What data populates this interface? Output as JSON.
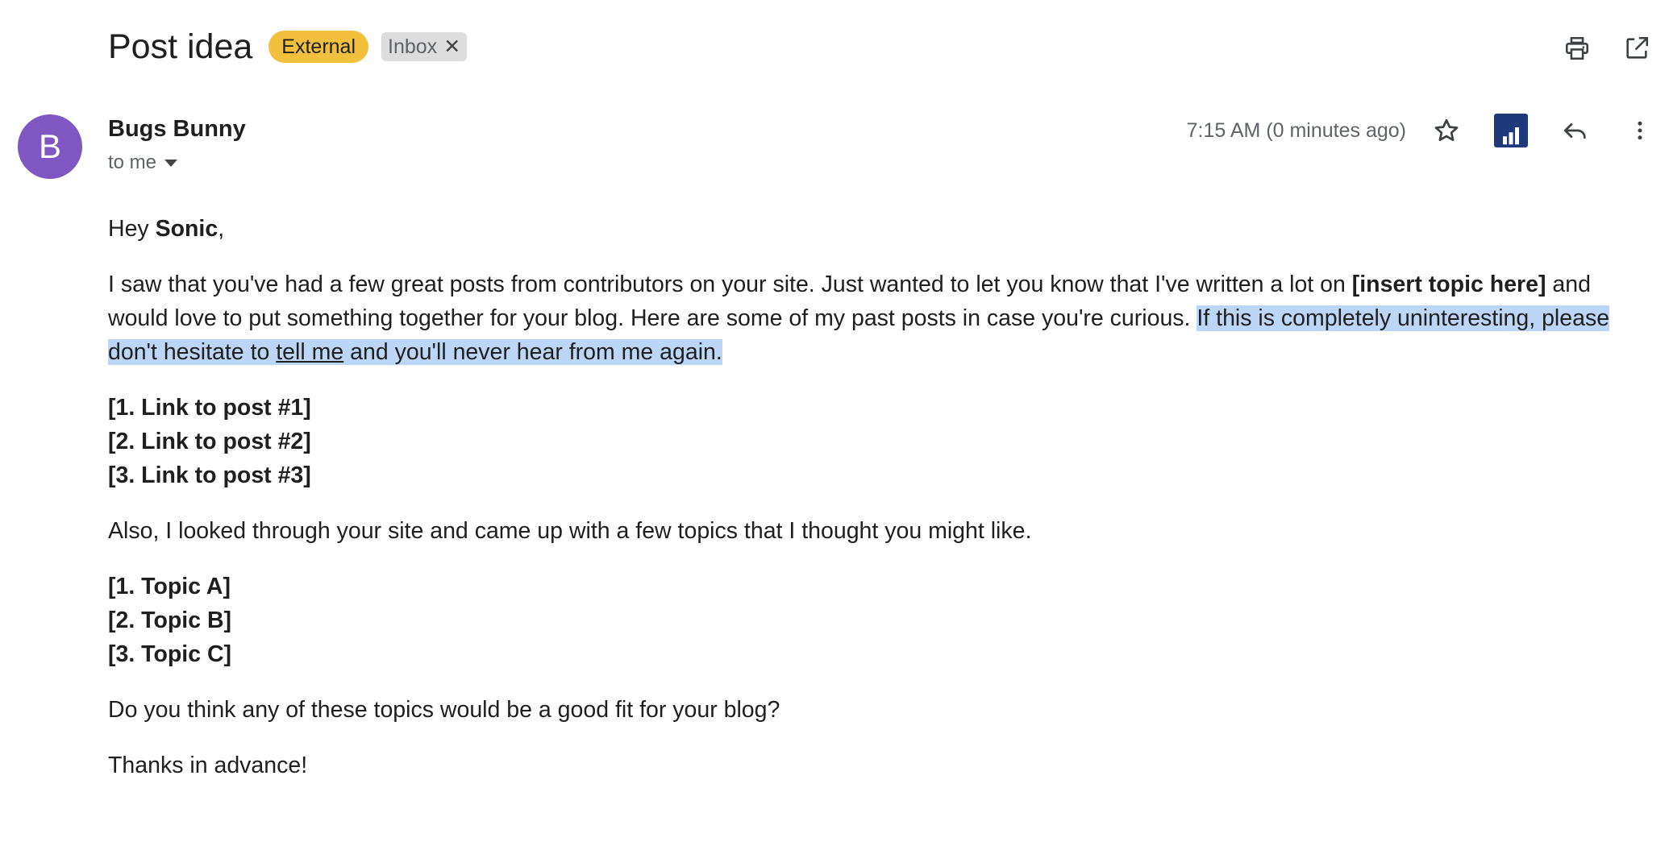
{
  "header": {
    "subject": "Post idea",
    "labels": [
      {
        "text": "External",
        "color": "#f2c03c"
      },
      {
        "text": "Inbox",
        "removable": true
      }
    ],
    "actions": [
      {
        "icon": "print-icon"
      },
      {
        "icon": "open-in-new-window-icon"
      }
    ]
  },
  "message": {
    "sender": {
      "initial": "B",
      "name": "Bugs Bunny",
      "avatar_color": "#7e57c2"
    },
    "recipient_label": "to me",
    "timestamp": "7:15 AM (0 minutes ago)",
    "actions": [
      {
        "icon": "star-icon"
      },
      {
        "icon": "analytics-extension-icon",
        "color": "#1f3a7a"
      },
      {
        "icon": "reply-icon"
      },
      {
        "icon": "more-vert-icon"
      }
    ]
  },
  "body": {
    "greeting_prefix": "Hey ",
    "greeting_name": "Sonic",
    "greeting_suffix": ",",
    "intro_part1": "I saw that you've had a few great posts from contributors on your site. Just wanted to let you know that I've written a lot on ",
    "intro_bold": "[insert topic here]",
    "intro_part2": " and would love to put something together for your blog. Here are some of my past posts in case you're curious. ",
    "highlight_part1": "If this is completely uninteresting, please don't hesitate to ",
    "highlight_link": "tell me",
    "highlight_part2": " and you'll never hear from me again.",
    "highlight_color": "#bcd6f7",
    "post_links": [
      "[1. Link to post #1]",
      "[2. Link to post #2]",
      "[3. Link to post #3]"
    ],
    "topics_intro": "Also, I looked through your site and came up with a few topics that I thought you might like.",
    "topics": [
      "[1. Topic A]",
      "[2. Topic B]",
      "[3. Topic C]"
    ],
    "question": "Do you think any of these topics would be a good fit for your blog?",
    "closing": "Thanks in advance!"
  }
}
